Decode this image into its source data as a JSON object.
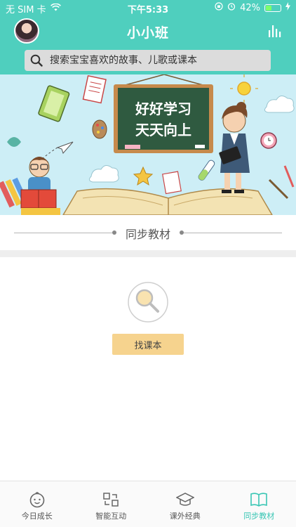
{
  "status": {
    "carrier": "无 SIM 卡",
    "time": "下午5:33",
    "battery_percent": "42%",
    "battery_level": 0.42
  },
  "nav": {
    "title": "小小班"
  },
  "search": {
    "placeholder": "搜索宝宝喜欢的故事、儿歌或课本"
  },
  "banner": {
    "board_line1": "好好学习",
    "board_line2": "天天向上"
  },
  "section": {
    "title": "同步教材"
  },
  "empty": {
    "find_label": "找课本"
  },
  "tabs": [
    {
      "label": "今日成长",
      "icon": "baby-face-icon",
      "active": false
    },
    {
      "label": "智能互动",
      "icon": "puzzle-icon",
      "active": false
    },
    {
      "label": "课外经典",
      "icon": "graduation-cap-icon",
      "active": false
    },
    {
      "label": "同步教材",
      "icon": "book-icon",
      "active": true
    }
  ],
  "colors": {
    "accent": "#4fcfbe",
    "tab_active": "#39c6b4",
    "button": "#f6d38e",
    "board": "#2f5a40"
  }
}
